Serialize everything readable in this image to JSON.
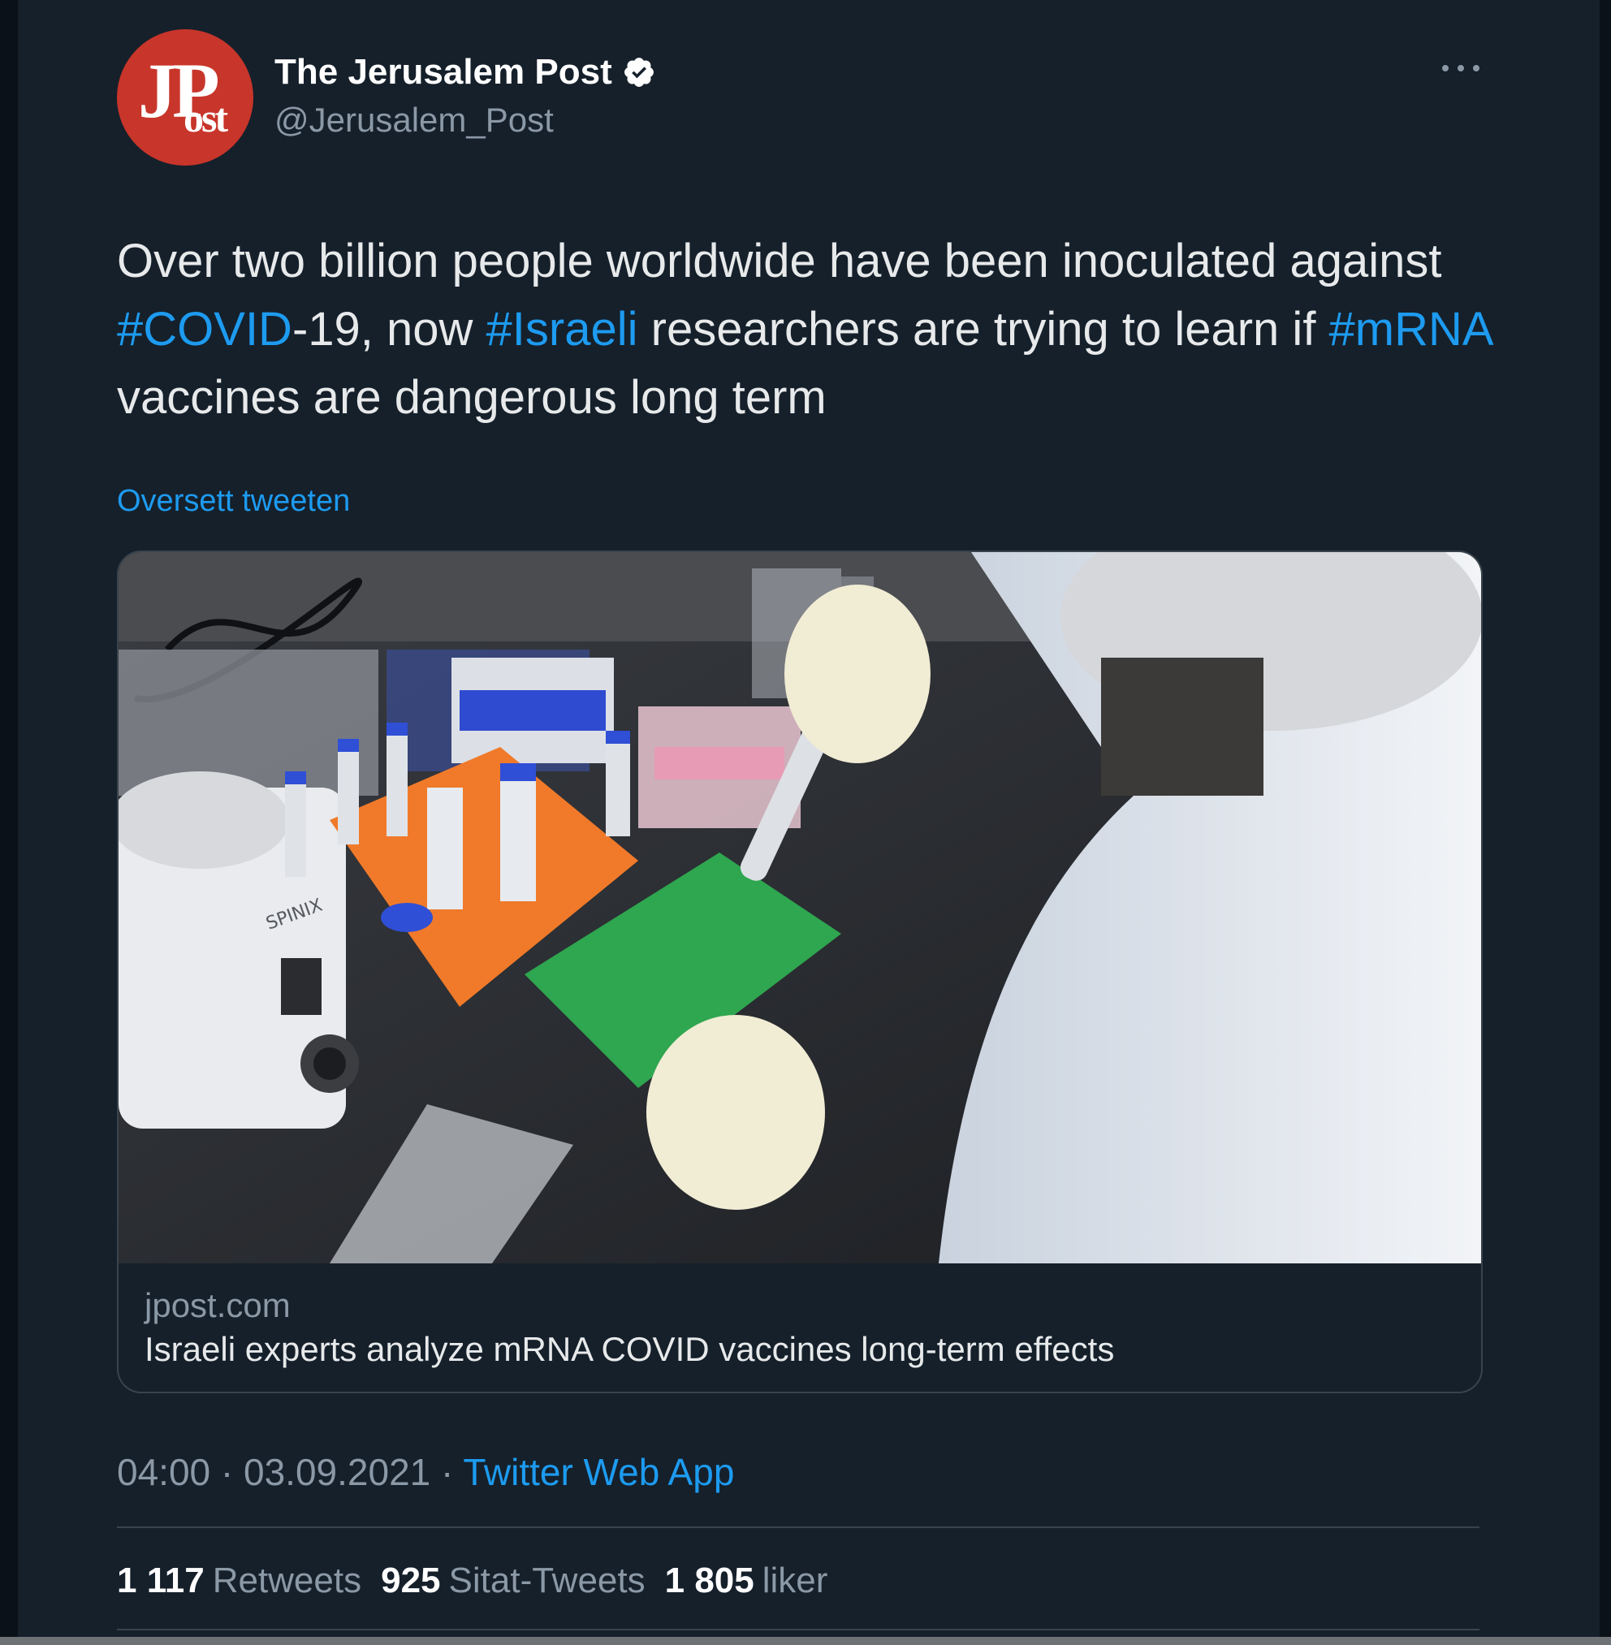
{
  "account": {
    "display_name": "The Jerusalem Post",
    "handle": "@Jerusalem_Post",
    "avatar_text": "JP",
    "avatar_text_small": "ost",
    "avatar_color": "#c8352a",
    "verified": true,
    "verified_icon": "verified-badge-icon"
  },
  "tweet": {
    "text_parts": {
      "p1": "Over two billion people worldwide have been inoculated against ",
      "tag1": "#COVID",
      "p2": "-19, now ",
      "tag2": "#Israeli",
      "p3": " researchers are trying to learn if ",
      "tag3": "#mRNA",
      "p4": " vaccines are dangerous long term"
    },
    "translate_label": "Oversett tweeten"
  },
  "card": {
    "domain": "jpost.com",
    "title": "Israeli experts analyze mRNA COVID vaccines long-term effects",
    "image_description": "lab photo",
    "image_labels": {
      "device": "SPINIX"
    }
  },
  "meta": {
    "time": "04:00",
    "separator": " · ",
    "date": "03.09.2021",
    "source": "Twitter Web App"
  },
  "stats": {
    "retweets_count": "1 117",
    "retweets_label": "Retweets",
    "quotes_count": "925",
    "quotes_label": "Sitat-Tweets",
    "likes_count": "1 805",
    "likes_label": "liker"
  },
  "colors": {
    "background": "#15202b",
    "link": "#1d9bf0",
    "secondary_text": "#8b98a5",
    "primary_text": "#e7e9ea",
    "border": "#38444d"
  }
}
